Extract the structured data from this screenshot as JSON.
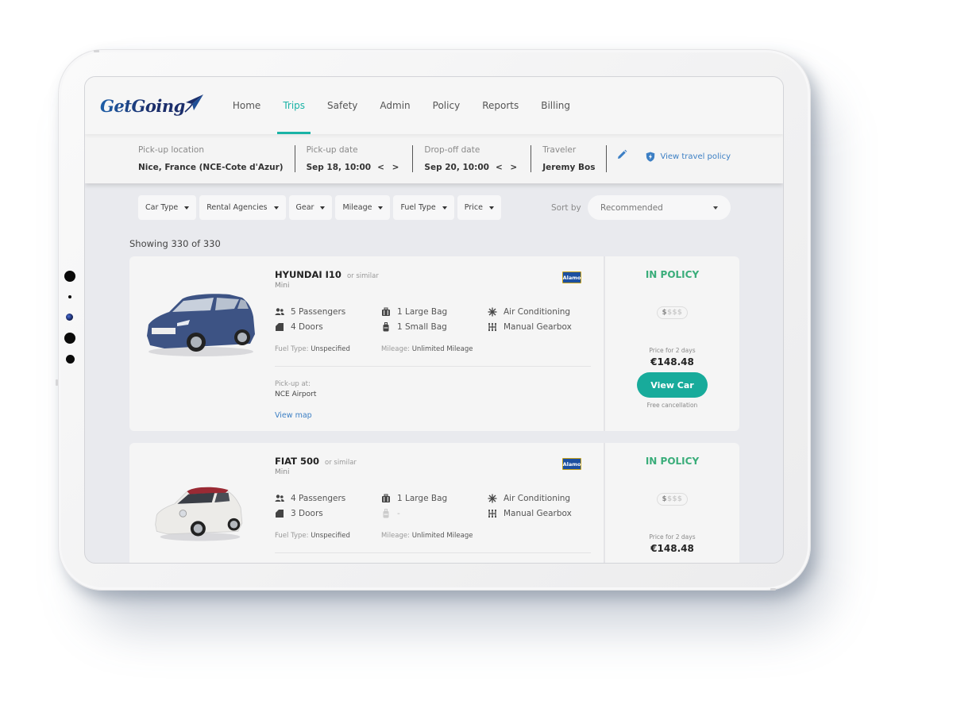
{
  "brand": {
    "name": "GetGoing"
  },
  "nav": {
    "items": [
      {
        "label": "Home",
        "active": false
      },
      {
        "label": "Trips",
        "active": true
      },
      {
        "label": "Safety",
        "active": false
      },
      {
        "label": "Admin",
        "active": false
      },
      {
        "label": "Policy",
        "active": false
      },
      {
        "label": "Reports",
        "active": false
      },
      {
        "label": "Billing",
        "active": false
      }
    ]
  },
  "search": {
    "pickup_location": {
      "label": "Pick-up location",
      "value": "Nice, France (NCE-Cote d'Azur)"
    },
    "pickup_date": {
      "label": "Pick-up date",
      "value": "Sep 18, 10:00",
      "arrows": "< >"
    },
    "dropoff_date": {
      "label": "Drop-off date",
      "value": "Sep 20, 10:00",
      "arrows": "< >"
    },
    "traveler": {
      "label": "Traveler",
      "value": "Jeremy Bos"
    },
    "policy_link": "View travel policy"
  },
  "filters": [
    "Car Type",
    "Rental Agencies",
    "Gear",
    "Mileage",
    "Fuel Type",
    "Price"
  ],
  "sort": {
    "label": "Sort by",
    "value": "Recommended"
  },
  "results": {
    "showing": "Showing 330 of 330"
  },
  "cars": [
    {
      "name": "HYUNDAI I10",
      "similar": "or similar",
      "class": "Mini",
      "agency": "Alamo",
      "passengers": "5 Passengers",
      "doors": "4 Doors",
      "large_bag": "1 Large Bag",
      "small_bag": "1 Small Bag",
      "ac": "Air Conditioning",
      "gearbox": "Manual Gearbox",
      "fuel_label": "Fuel Type:",
      "fuel": "Unspecified",
      "mileage_label": "Mileage:",
      "mileage": "Unlimited Mileage",
      "pickup_label": "Pick-up at:",
      "pickup": "NCE Airport",
      "view_map": "View map",
      "policy_status": "IN POLICY",
      "price_level": {
        "active": "$",
        "inactive": "$$$"
      },
      "price_for": "Price for 2 days",
      "price": "€148.48",
      "cta": "View Car",
      "cancellation": "Free cancellation",
      "body_color": "#3d5384"
    },
    {
      "name": "FIAT 500",
      "similar": "or similar",
      "class": "Mini",
      "agency": "Alamo",
      "passengers": "4 Passengers",
      "doors": "3 Doors",
      "large_bag": "1 Large Bag",
      "small_bag": "-",
      "ac": "Air Conditioning",
      "gearbox": "Manual Gearbox",
      "fuel_label": "Fuel Type:",
      "fuel": "Unspecified",
      "mileage_label": "Mileage:",
      "mileage": "Unlimited Mileage",
      "policy_status": "IN POLICY",
      "price_level": {
        "active": "$",
        "inactive": "$$$"
      },
      "price_for": "Price for 2 days",
      "price": "€148.48",
      "body_color": "#ecebe8"
    }
  ],
  "colors": {
    "accent": "#1ab3a6",
    "in_policy": "#3aad7a",
    "link": "#3c7fc4",
    "cta": "#18ab9b"
  }
}
